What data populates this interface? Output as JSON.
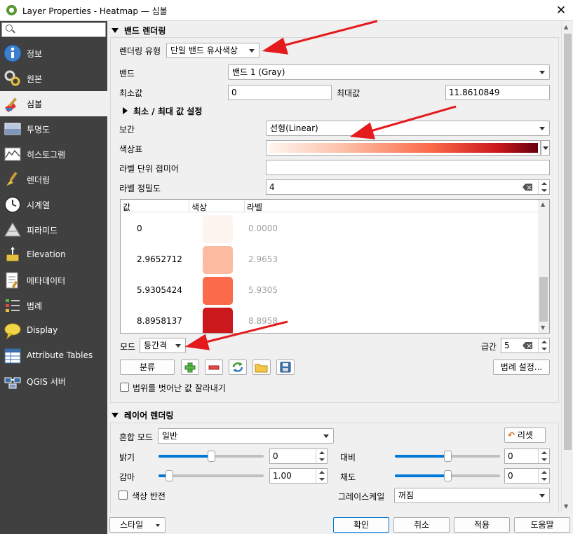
{
  "window": {
    "title": "Layer Properties - Heatmap — 심볼",
    "close_glyph": "✕"
  },
  "sidebar": {
    "search_placeholder": "",
    "items": [
      {
        "label": "정보",
        "icon": "info-icon"
      },
      {
        "label": "원본",
        "icon": "source-icon"
      },
      {
        "label": "심볼",
        "icon": "symbology-brush-icon",
        "selected": true
      },
      {
        "label": "투명도",
        "icon": "transparency-icon"
      },
      {
        "label": "히스토그램",
        "icon": "histogram-icon"
      },
      {
        "label": "렌더링",
        "icon": "rendering-brush-icon"
      },
      {
        "label": "시계열",
        "icon": "clock-icon"
      },
      {
        "label": "피라미드",
        "icon": "pyramid-icon"
      },
      {
        "label": "Elevation",
        "icon": "elevation-icon"
      },
      {
        "label": "메타데이터",
        "icon": "metadata-icon"
      },
      {
        "label": "범례",
        "icon": "legend-icon"
      },
      {
        "label": "Display",
        "icon": "display-bubble-icon"
      },
      {
        "label": "Attribute Tables",
        "icon": "table-icon"
      },
      {
        "label": "QGIS 서버",
        "icon": "server-icon"
      }
    ]
  },
  "band_rendering": {
    "section_title": "밴드 렌더링",
    "render_type_label": "렌더링 유형",
    "render_type_value": "단일 밴드 유사색상",
    "band_label": "밴드",
    "band_value": "밴드 1 (Gray)",
    "min_label": "최소값",
    "min_value": "0",
    "max_label": "최대값",
    "max_value": "11.8610849",
    "minmax_settings_label": "최소 / 최대 값 설정",
    "interp_label": "보간",
    "interp_value": "선형(Linear)",
    "ramp_label": "색상표",
    "unit_suffix_label": "라벨 단위 접미어",
    "unit_suffix_value": "",
    "precision_label": "라벨 정밀도",
    "precision_value": "4",
    "table": {
      "headers": [
        "값",
        "색상",
        "라벨"
      ],
      "rows": [
        {
          "value": "0",
          "color": "#fff5f0",
          "label": "0.0000"
        },
        {
          "value": "2.9652712",
          "color": "#fcbba1",
          "label": "2.9653"
        },
        {
          "value": "5.9305424",
          "color": "#fb6a4a",
          "label": "5.9305"
        },
        {
          "value": "8.8958137",
          "color": "#cb181d",
          "label": "8.8958"
        }
      ]
    },
    "mode_label": "모드",
    "mode_value": "등간격",
    "classes_label": "급간",
    "classes_value": "5",
    "classify_button": "분류",
    "legend_settings_button": "범례 설정...",
    "clip_checkbox_label": "범위를 벗어난 값 잘라내기",
    "clip_checked": false
  },
  "layer_rendering": {
    "section_title": "레이어 렌더링",
    "blend_label": "혼합 모드",
    "blend_value": "일반",
    "reset_button": "리셋",
    "brightness_label": "밝기",
    "brightness_value": "0",
    "brightness_level": 0.5,
    "contrast_label": "대비",
    "contrast_value": "0",
    "contrast_level": 0.5,
    "gamma_label": "감마",
    "gamma_value": "1.00",
    "gamma_level": 0.1,
    "saturation_label": "채도",
    "saturation_value": "0",
    "saturation_level": 0.5,
    "invert_label": "색상 반전",
    "grayscale_label": "그레이스케일",
    "grayscale_value": "꺼짐"
  },
  "footer": {
    "style_button": "스타일",
    "ok_button": "확인",
    "cancel_button": "취소",
    "apply_button": "적용",
    "help_button": "도움말"
  },
  "colors": {
    "accent": "#0078d7",
    "sidebar_bg": "#404040",
    "annotation": "#e41a1c"
  }
}
